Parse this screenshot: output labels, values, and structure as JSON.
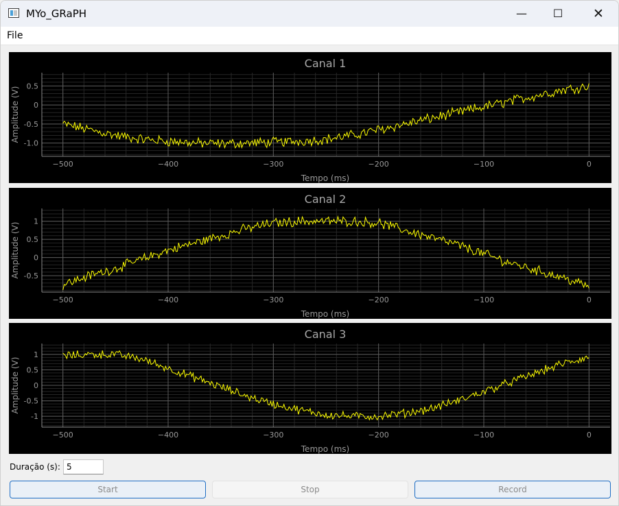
{
  "window": {
    "title": "MYo_GRaPH",
    "icon": "app-window-icon",
    "minimize_icon": "minimize-icon",
    "maximize_icon": "maximize-icon",
    "close_icon": "close-icon",
    "minimize_glyph": "—",
    "maximize_glyph": "☐",
    "close_glyph": "✕"
  },
  "menu": {
    "file_label": "File"
  },
  "colors": {
    "plot_background": "#000000",
    "trace": "#ffff00",
    "grid_major": "#5a5a5a",
    "grid_minor": "#262626",
    "axis_text": "#9a9a9a",
    "title_text": "#a8a8a8"
  },
  "controls": {
    "duration_label": "Duração (s):",
    "duration_value": "5",
    "start_label": "Start",
    "stop_label": "Stop",
    "record_label": "Record"
  },
  "chart_data": [
    {
      "type": "line",
      "title": "Canal 1",
      "xlabel": "Tempo (ms)",
      "ylabel": "Amplitude (V)",
      "xlim": [
        -520,
        20
      ],
      "ylim": [
        -1.35,
        0.85
      ],
      "xticks": [
        -500,
        -400,
        -300,
        -200,
        -100,
        0
      ],
      "yticks": [
        0.5,
        0,
        -0.5,
        -1.0
      ],
      "ytick_labels": [
        "0.5",
        "0",
        "-0.5",
        "-1.0"
      ],
      "grid": true,
      "series": [
        {
          "x": [
            -500,
            -475,
            -450,
            -425,
            -400,
            -375,
            -350,
            -325,
            -300,
            -275,
            -250,
            -225,
            -200,
            -175,
            -150,
            -125,
            -100,
            -75,
            -50,
            -25,
            0
          ],
          "values": [
            -0.5,
            -0.65,
            -0.8,
            -0.9,
            -0.95,
            -1.0,
            -1.02,
            -1.0,
            -0.98,
            -0.95,
            -0.9,
            -0.8,
            -0.65,
            -0.5,
            -0.35,
            -0.2,
            -0.05,
            0.1,
            0.25,
            0.4,
            0.5
          ]
        }
      ]
    },
    {
      "type": "line",
      "title": "Canal 2",
      "xlabel": "Tempo (ms)",
      "ylabel": "Amplitude (V)",
      "xlim": [
        -520,
        20
      ],
      "ylim": [
        -0.95,
        1.35
      ],
      "xticks": [
        -500,
        -400,
        -300,
        -200,
        -100,
        0
      ],
      "yticks": [
        1,
        0.5,
        0,
        -0.5
      ],
      "ytick_labels": [
        "1",
        "0.5",
        "0",
        "-0.5"
      ],
      "grid": true,
      "series": [
        {
          "x": [
            -500,
            -475,
            -450,
            -425,
            -400,
            -375,
            -350,
            -325,
            -300,
            -275,
            -250,
            -225,
            -200,
            -175,
            -150,
            -125,
            -100,
            -75,
            -50,
            -25,
            0
          ],
          "values": [
            -0.75,
            -0.5,
            -0.3,
            -0.05,
            0.2,
            0.4,
            0.6,
            0.8,
            0.95,
            1.0,
            1.0,
            1.0,
            0.95,
            0.75,
            0.55,
            0.35,
            0.1,
            -0.15,
            -0.35,
            -0.55,
            -0.8
          ]
        }
      ]
    },
    {
      "type": "line",
      "title": "Canal 3",
      "xlabel": "Tempo (ms)",
      "ylabel": "Amplitude (V)",
      "xlim": [
        -520,
        20
      ],
      "ylim": [
        -1.35,
        1.35
      ],
      "xticks": [
        -500,
        -400,
        -300,
        -200,
        -100,
        0
      ],
      "yticks": [
        1,
        0.5,
        0,
        -0.5,
        -1
      ],
      "ytick_labels": [
        "1",
        "0.5",
        "0",
        "-0.5",
        "-1"
      ],
      "grid": true,
      "series": [
        {
          "x": [
            -500,
            -475,
            -450,
            -425,
            -400,
            -375,
            -350,
            -325,
            -300,
            -275,
            -250,
            -225,
            -200,
            -175,
            -150,
            -125,
            -100,
            -75,
            -50,
            -25,
            0
          ],
          "values": [
            0.95,
            1.0,
            1.0,
            0.85,
            0.55,
            0.25,
            -0.05,
            -0.35,
            -0.6,
            -0.8,
            -0.95,
            -1.0,
            -1.0,
            -0.9,
            -0.75,
            -0.5,
            -0.2,
            0.1,
            0.4,
            0.7,
            0.9
          ]
        }
      ]
    }
  ]
}
